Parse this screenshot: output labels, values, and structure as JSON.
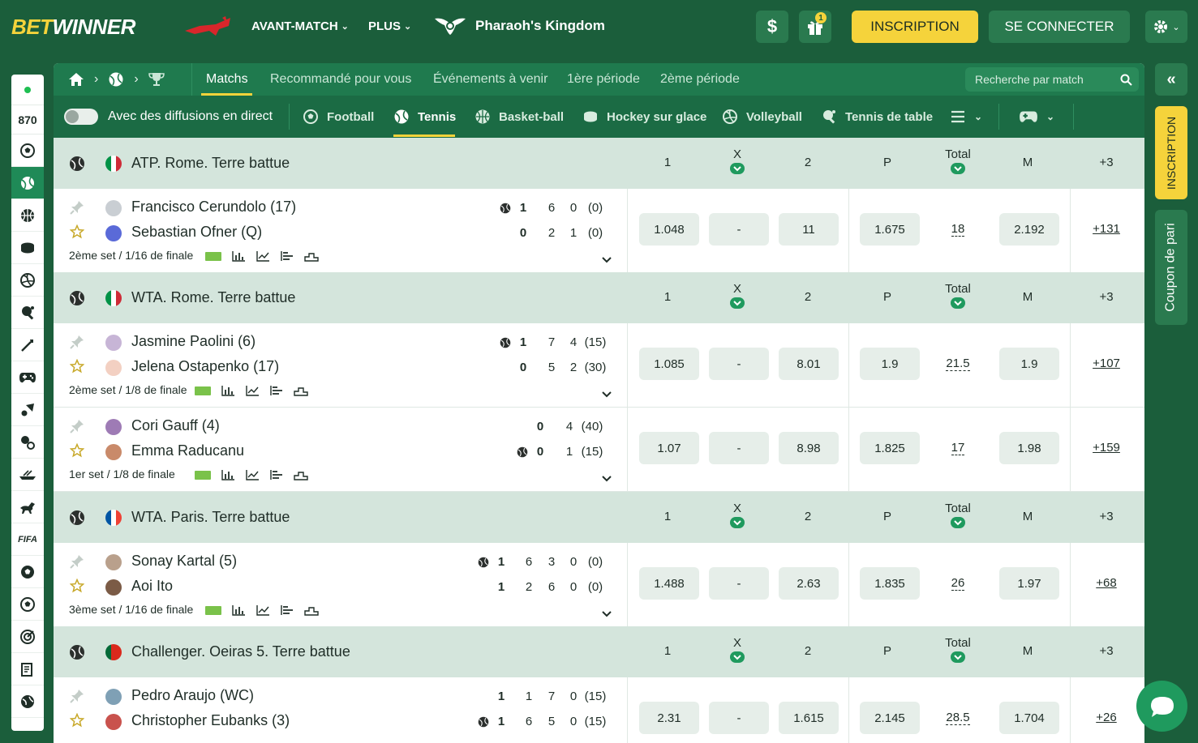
{
  "header": {
    "logo_left": "BET",
    "logo_right": "WINNER",
    "nav": [
      {
        "label": "AVANT-MATCH"
      },
      {
        "label": "PLUS"
      }
    ],
    "promo": "Pharaoh's Kingdom",
    "gift_count": "1",
    "dollar": "$",
    "register": "INSCRIPTION",
    "login": "SE CONNECTER"
  },
  "left_sidebar": {
    "count": "870",
    "fifa": "FIFA"
  },
  "tabs": {
    "items": [
      {
        "label": "Matchs"
      },
      {
        "label": "Recommandé pour vous"
      },
      {
        "label": "Événements à venir"
      },
      {
        "label": "1ère période"
      },
      {
        "label": "2ème période"
      }
    ],
    "search_placeholder": "Recherche par match"
  },
  "sports_bar": {
    "live_toggle": "Avec des diffusions en direct",
    "sports": [
      {
        "label": "Football",
        "icon": "football-icon"
      },
      {
        "label": "Tennis",
        "icon": "tennis-icon"
      },
      {
        "label": "Basket-ball",
        "icon": "basketball-icon"
      },
      {
        "label": "Hockey sur glace",
        "icon": "hockey-icon"
      },
      {
        "label": "Volleyball",
        "icon": "volleyball-icon"
      },
      {
        "label": "Tennis de table",
        "icon": "table-tennis-icon"
      }
    ]
  },
  "columns": {
    "c1": "1",
    "cx": "X",
    "c2": "2",
    "cp": "P",
    "ctotal": "Total",
    "cm": "M",
    "cmore": "+3"
  },
  "leagues": [
    {
      "name": "ATP. Rome. Terre battue",
      "matches": [
        {
          "p1": "Francisco Cerundolo (17)",
          "p2": "Sebastian Ofner (Q)",
          "s1": [
            "1",
            "6",
            "0",
            "(0)"
          ],
          "s2": [
            "0",
            "2",
            "1",
            "(0)"
          ],
          "stage": "2ème set / 1/16 de finale",
          "odds": {
            "o1": "1.048",
            "ox": "-",
            "o2": "11",
            "p": "1.675",
            "total": "18",
            "m": "2.192",
            "more": "+131"
          }
        }
      ]
    },
    {
      "name": "WTA. Rome. Terre battue",
      "matches": [
        {
          "p1": "Jasmine Paolini (6)",
          "p2": "Jelena Ostapenko (17)",
          "s1": [
            "1",
            "7",
            "4",
            "(15)"
          ],
          "s2": [
            "0",
            "5",
            "2",
            "(30)"
          ],
          "stage": "2ème set / 1/8 de finale",
          "odds": {
            "o1": "1.085",
            "ox": "-",
            "o2": "8.01",
            "p": "1.9",
            "total": "21.5",
            "m": "1.9",
            "more": "+107"
          }
        },
        {
          "p1": "Cori Gauff (4)",
          "p2": "Emma Raducanu",
          "s1": [
            "0",
            "4",
            "(40)"
          ],
          "s2": [
            "0",
            "1",
            "(15)"
          ],
          "stage": "1er set / 1/8 de finale",
          "odds": {
            "o1": "1.07",
            "ox": "-",
            "o2": "8.98",
            "p": "1.825",
            "total": "17",
            "m": "1.98",
            "more": "+159"
          }
        }
      ]
    },
    {
      "name": "WTA. Paris. Terre battue",
      "matches": [
        {
          "p1": "Sonay Kartal (5)",
          "p2": "Aoi Ito",
          "s1": [
            "1",
            "6",
            "3",
            "0",
            "(0)"
          ],
          "s2": [
            "1",
            "2",
            "6",
            "0",
            "(0)"
          ],
          "stage": "3ème set / 1/16 de finale",
          "odds": {
            "o1": "1.488",
            "ox": "-",
            "o2": "2.63",
            "p": "1.835",
            "total": "26",
            "m": "1.97",
            "more": "+68"
          }
        }
      ]
    },
    {
      "name": "Challenger. Oeiras 5. Terre battue",
      "matches": [
        {
          "p1": "Pedro Araujo (WC)",
          "p2": "Christopher Eubanks (3)",
          "s1": [
            "1",
            "1",
            "7",
            "0",
            "(15)"
          ],
          "s2": [
            "1",
            "6",
            "5",
            "0",
            "(15)"
          ],
          "odds": {
            "o1": "2.31",
            "ox": "-",
            "o2": "1.615",
            "p": "2.145",
            "total": "28.5",
            "m": "1.704",
            "more": "+26"
          }
        }
      ]
    }
  ],
  "right_panel": {
    "register_vertical": "INSCRIPTION",
    "coupon": "Coupon de pari"
  },
  "colors": {
    "brand_green": "#1b5e3b",
    "accent_yellow": "#f5d33b",
    "league_bg": "#d4e5dc"
  }
}
